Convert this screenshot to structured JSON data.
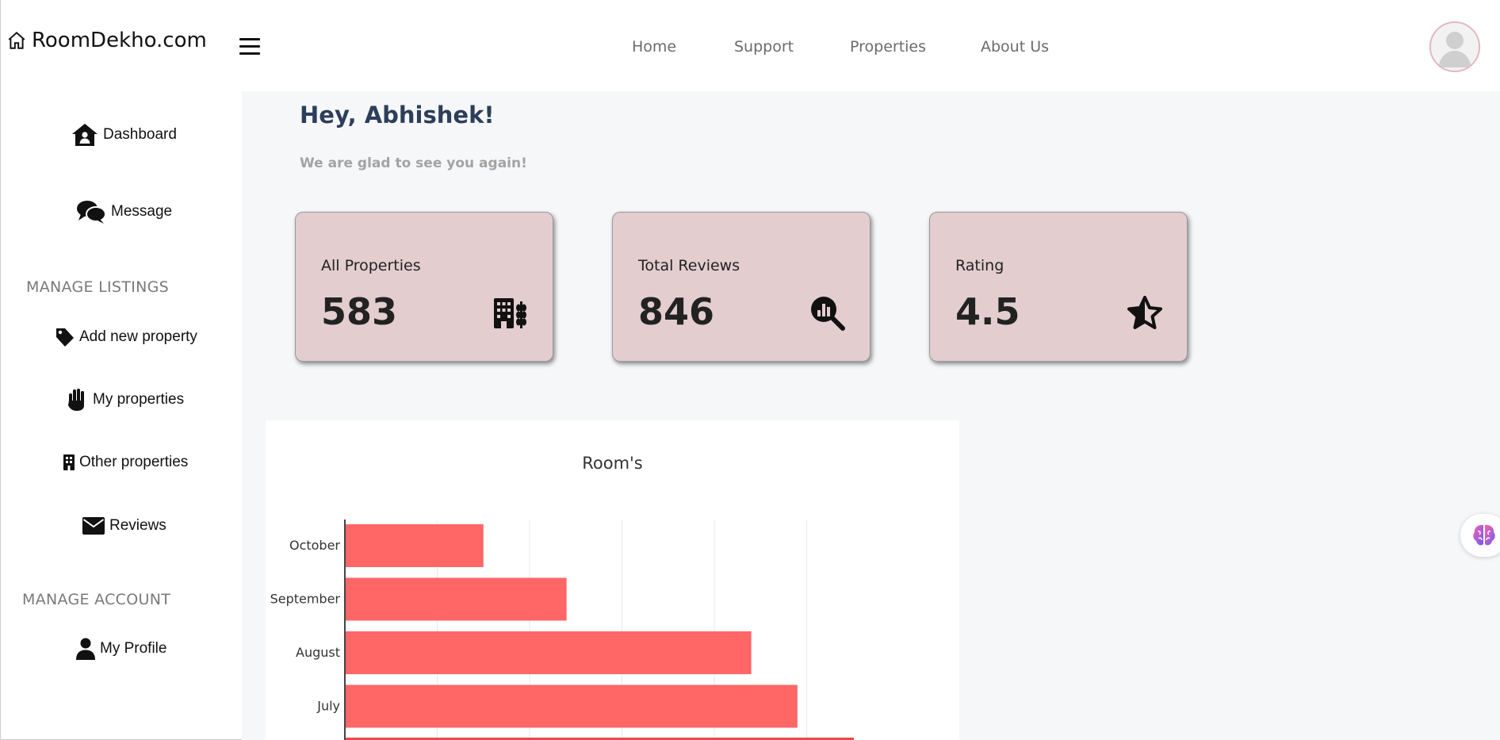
{
  "brand": {
    "name": "RoomDekho.com",
    "icon": "home-icon"
  },
  "nav": {
    "home": "Home",
    "support": "Support",
    "properties": "Properties",
    "about": "About Us"
  },
  "sidebar": {
    "dashboard": "Dashboard",
    "message": "Message",
    "manage_listings": "MANAGE LISTINGS",
    "add_new_property": "Add new property",
    "my_properties": "My properties",
    "other_properties": "Other properties",
    "reviews": "Reviews",
    "manage_account": "MANAGE ACCOUNT",
    "my_profile": "My Profile"
  },
  "greeting": {
    "title": "Hey, Abhishek!",
    "subtitle": "We are glad to see you again!"
  },
  "cards": [
    {
      "label": "All Properties",
      "value": "583",
      "icon": "buildings-icon"
    },
    {
      "label": "Total Reviews",
      "value": "846",
      "icon": "search-chart-icon"
    },
    {
      "label": "Rating",
      "value": "4.5",
      "icon": "star-icon"
    }
  ],
  "colors": {
    "bar": "#ff6666",
    "card_bg": "#e3cdcf",
    "main_bg": "#f6f7f9"
  },
  "chart_data": {
    "type": "bar",
    "orientation": "horizontal",
    "title": "Room's",
    "categories": [
      "October",
      "September",
      "August",
      "July"
    ],
    "values": [
      1.5,
      2.4,
      4.4,
      4.9
    ],
    "xlim": [
      0,
      5.5
    ],
    "grid": true
  }
}
